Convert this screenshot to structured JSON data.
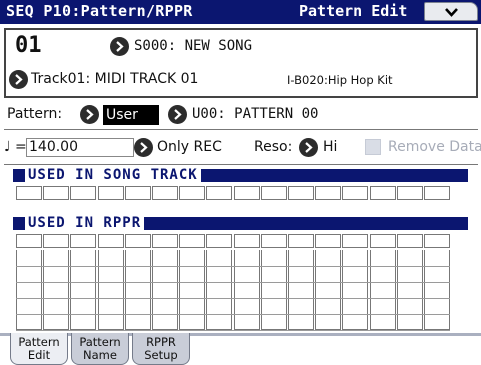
{
  "title_bar": {
    "title": "SEQ P10:Pattern/RPPR",
    "page": "Pattern Edit",
    "menu_icon": "chevron-down-icon"
  },
  "header": {
    "song_number": "01",
    "song_name": "S000: NEW SONG",
    "track": "Track01: MIDI TRACK 01",
    "program": "I-B020:Hip Hop Kit"
  },
  "pattern_row": {
    "label": "Pattern:",
    "bank": "User",
    "pattern": "U00: PATTERN 00"
  },
  "tempo_row": {
    "note_symbol": "♩ =",
    "tempo": "140.00",
    "mode": "Only REC",
    "reso_label": "Reso:",
    "reso_value": "Hi",
    "remove_label": "Remove Data"
  },
  "sections": {
    "song_track_title": "USED IN SONG TRACK",
    "rppr_title": "USED IN RPPR"
  },
  "grid": {
    "columns": 16,
    "song_track_rows": 1,
    "rppr_rows": 6
  },
  "tabs": [
    {
      "line1": "Pattern",
      "line2": "Edit",
      "active": true
    },
    {
      "line1": "Pattern",
      "line2": "Name",
      "active": false
    },
    {
      "line1": "RPPR",
      "line2": "Setup",
      "active": false
    }
  ],
  "colors": {
    "accent": "#0b1670",
    "selection": "#000000",
    "disabled_text": "#a7acb8"
  }
}
